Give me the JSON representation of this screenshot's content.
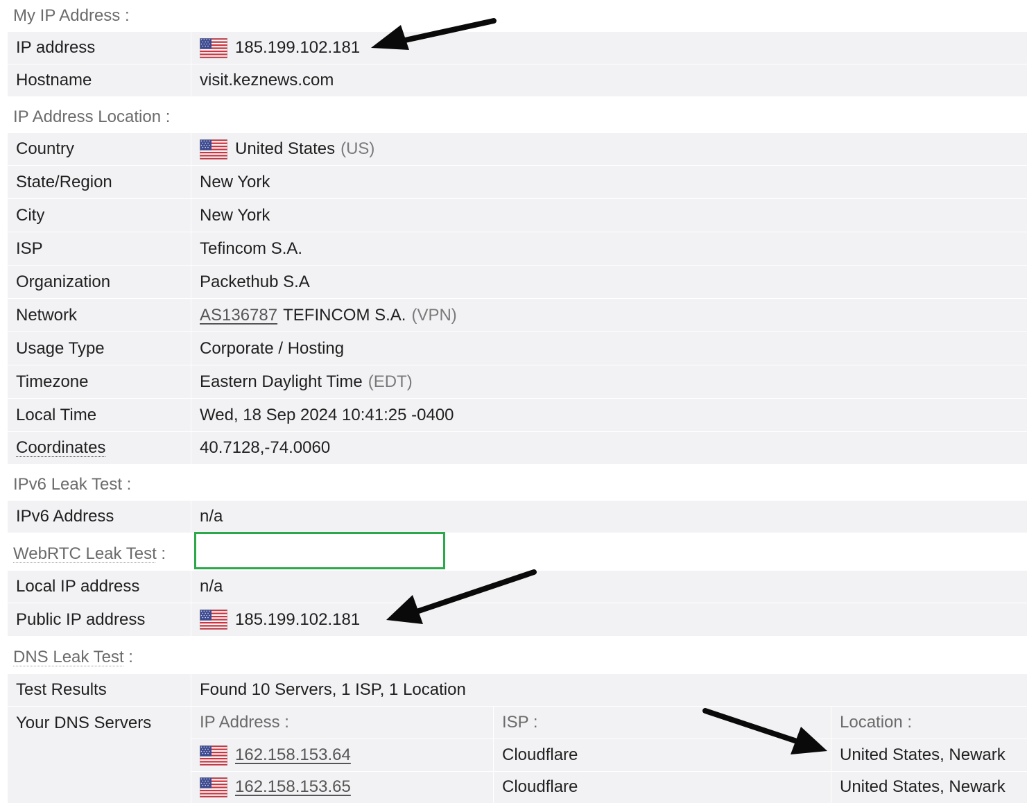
{
  "sections": {
    "my_ip": "My IP Address :",
    "location": "IP Address Location :",
    "ipv6": "IPv6 Leak Test :",
    "webrtc_label": "WebRTC Leak Test",
    "webrtc_colon": " :",
    "dns_label": "DNS Leak Test",
    "dns_colon": " :"
  },
  "my_ip": {
    "ip_label": "IP address",
    "ip_value": "185.199.102.181",
    "host_label": "Hostname",
    "host_value": "visit.keznews.com"
  },
  "location": {
    "country_label": "Country",
    "country_value": "United States",
    "country_code": "(US)",
    "region_label": "State/Region",
    "region_value": "New York",
    "city_label": "City",
    "city_value": "New York",
    "isp_label": "ISP",
    "isp_value": "Tefincom S.A.",
    "org_label": "Organization",
    "org_value": "Packethub S.A",
    "network_label": "Network",
    "network_asn": "AS136787",
    "network_name": "TEFINCOM S.A.",
    "network_tag": "(VPN)",
    "usage_label": "Usage Type",
    "usage_value": "Corporate / Hosting",
    "tz_label": "Timezone",
    "tz_value": "Eastern Daylight Time",
    "tz_abbr": "(EDT)",
    "time_label": "Local Time",
    "time_value": "Wed, 18 Sep 2024 10:41:25 -0400",
    "coord_label": "Coordinates",
    "coord_value": "40.7128,-74.0060"
  },
  "ipv6": {
    "addr_label": "IPv6 Address",
    "addr_value": "n/a"
  },
  "webrtc": {
    "local_label": "Local IP address",
    "local_value": "n/a",
    "public_label": "Public IP address",
    "public_value": "185.199.102.181"
  },
  "dns": {
    "results_label": "Test Results",
    "results_value": "Found 10 Servers, 1 ISP, 1 Location",
    "servers_label": "Your DNS Servers",
    "col_ip": "IP Address :",
    "col_isp": "ISP :",
    "col_location": "Location :",
    "servers": [
      {
        "ip": "162.158.153.64",
        "isp": "Cloudflare",
        "location": "United States, Newark"
      },
      {
        "ip": "162.158.153.65",
        "isp": "Cloudflare",
        "location": "United States, Newark"
      }
    ]
  },
  "colors": {
    "row_bg": "#f2f2f4",
    "section_text": "#6b6b6b",
    "highlight_box": "#2aa84a",
    "arrow": "#0a0a0a"
  },
  "icons": [
    "us-flag-icon",
    "arrow-annotation"
  ]
}
